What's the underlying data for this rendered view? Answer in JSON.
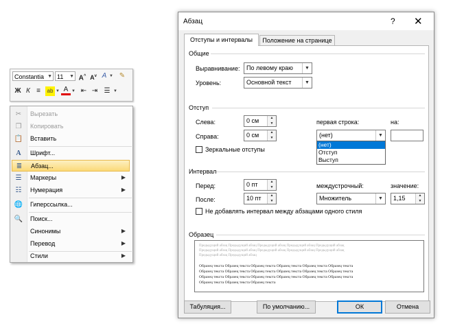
{
  "mini_toolbar": {
    "font_name": "Constantia",
    "font_size": "11",
    "buttons_row1": [
      "A˄",
      "A˅",
      "A"
    ],
    "buttons_row2": [
      "Ж",
      "К",
      "≡",
      "A"
    ]
  },
  "context_menu": {
    "items": [
      {
        "label": "Вырезать",
        "icon": "scissors-icon",
        "disabled": true
      },
      {
        "label": "Копировать",
        "icon": "copy-icon",
        "disabled": true
      },
      {
        "label": "Вставить",
        "icon": "paste-icon"
      },
      {
        "label": "Шрифт...",
        "icon": "font-icon"
      },
      {
        "label": "Абзац...",
        "icon": "paragraph-icon",
        "highlighted": true
      },
      {
        "label": "Маркеры",
        "icon": "bullets-icon",
        "submenu": true
      },
      {
        "label": "Нумерация",
        "icon": "numbering-icon",
        "submenu": true
      },
      {
        "label": "Гиперссылка...",
        "icon": "hyperlink-icon"
      },
      {
        "label": "Поиск...",
        "icon": "search-icon"
      },
      {
        "label": "Синонимы",
        "submenu": true
      },
      {
        "label": "Перевод",
        "submenu": true
      },
      {
        "label": "Стили",
        "submenu": true
      }
    ]
  },
  "dialog": {
    "title": "Абзац",
    "help": "?",
    "close": "✕",
    "tabs": [
      "Отступы и интервалы",
      "Положение на странице"
    ],
    "general": {
      "section": "Общие",
      "alignment_label": "Выравнивание:",
      "alignment_value": "По левому краю",
      "level_label": "Уровень:",
      "level_value": "Основной текст"
    },
    "indent": {
      "section": "Отступ",
      "left_label": "Слева:",
      "left_value": "0 см",
      "right_label": "Справа:",
      "right_value": "0 см",
      "first_line_label": "первая строка:",
      "first_line_value": "(нет)",
      "by_label": "на:",
      "mirror_label": "Зеркальные отступы",
      "dropdown_options": [
        "(нет)",
        "Отступ",
        "Выступ"
      ]
    },
    "spacing": {
      "section": "Интервал",
      "before_label": "Перед:",
      "before_value": "0 пт",
      "after_label": "После:",
      "after_value": "10 пт",
      "line_label": "междустрочный:",
      "line_value": "Множитель",
      "value_label": "значение:",
      "value_value": "1,15",
      "no_space_label": "Не добавлять интервал между абзацами одного стиля"
    },
    "sample": {
      "section": "Образец",
      "prev_lines": [
        "Предыдущий абзац Предыдущий абзац Предыдущий абзац Предыдущий абзац Предыдущий абзац",
        "Предыдущий абзац Предыдущий абзац Предыдущий абзац Предыдущий абзац Предыдущий абзац",
        "Предыдущий абзац Предыдущий абзац"
      ],
      "cur_lines": [
        "Образец текста Образец текста Образец текста Образец текста Образец текста Образец текста",
        "Образец текста Образец текста Образец текста Образец текста Образец текста Образец текста",
        "Образец текста Образец текста Образец текста Образец текста Образец текста Образец текста",
        "Образец текста Образец текста Образец текста"
      ]
    },
    "buttons": {
      "tabs": "Табуляция...",
      "default": "По умолчанию...",
      "ok": "ОК",
      "cancel": "Отмена"
    }
  }
}
